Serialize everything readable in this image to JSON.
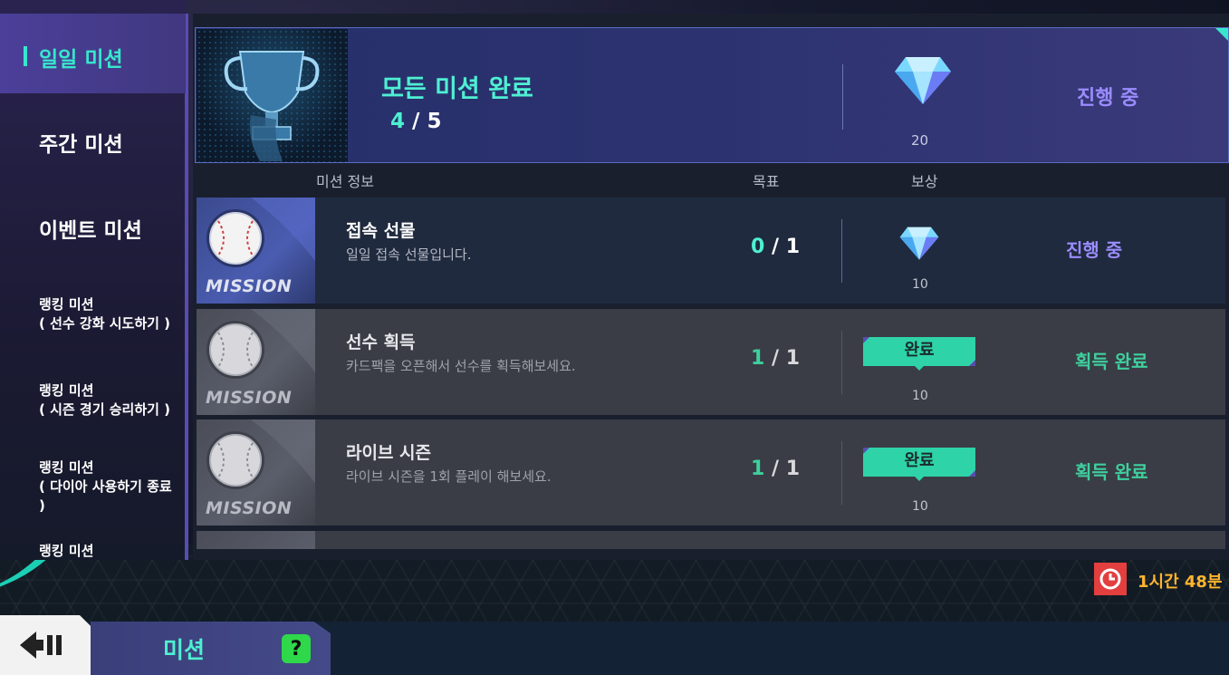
{
  "sidebar": {
    "items": [
      {
        "label": "일일 미션"
      },
      {
        "label": "주간 미션"
      },
      {
        "label": "이벤트 미션"
      },
      {
        "line1": "랭킹 미션",
        "line2": "( 선수 강화 시도하기 )"
      },
      {
        "line1": "랭킹 미션",
        "line2": "( 시즌 경기 승리하기 )"
      },
      {
        "line1": "랭킹 미션",
        "line2": "( 다이아 사용하기 종료",
        "line3": ")"
      },
      {
        "line1": "랭킹 미션"
      }
    ]
  },
  "banner": {
    "title": "모든 미션 완료",
    "progress_current": "4",
    "progress_sep": "/",
    "progress_total": "5",
    "reward_amount": "20",
    "status": "진행 중"
  },
  "headers": {
    "info": "미션 정보",
    "goal": "목표",
    "reward": "보상"
  },
  "missions": [
    {
      "icon_label": "MISSION",
      "title": "접속 선물",
      "desc": "일일 접속 선물입니다.",
      "current": "0",
      "sep": "/",
      "total": "1",
      "reward_amount": "10",
      "status": "진행 중"
    },
    {
      "icon_label": "MISSION",
      "title": "선수 획득",
      "desc": "카드팩을 오픈해서 선수를 획득해보세요.",
      "current": "1",
      "sep": "/",
      "total": "1",
      "reward_tag": "완료",
      "reward_amount": "10",
      "status": "획득 완료"
    },
    {
      "icon_label": "MISSION",
      "title": "라이브 시즌",
      "desc": "라이브 시즌을 1회 플레이 해보세요.",
      "current": "1",
      "sep": "/",
      "total": "1",
      "reward_tag": "완료",
      "reward_amount": "10",
      "status": "획득 완료"
    }
  ],
  "timer": {
    "text": "1시간 48분"
  },
  "bottom": {
    "tab_title": "미션",
    "help_label": "?"
  },
  "colors": {
    "accent_teal": "#4ef0d2",
    "status_purple": "#9b8cff",
    "status_done_green": "#3fcf9e",
    "timer_orange": "#ffb52e",
    "timer_red": "#e33f3f",
    "help_green": "#2ed84a"
  },
  "icons": [
    "trophy-icon",
    "diamond-icon",
    "baseball-icon",
    "clock-icon",
    "back-arrow-icon"
  ]
}
